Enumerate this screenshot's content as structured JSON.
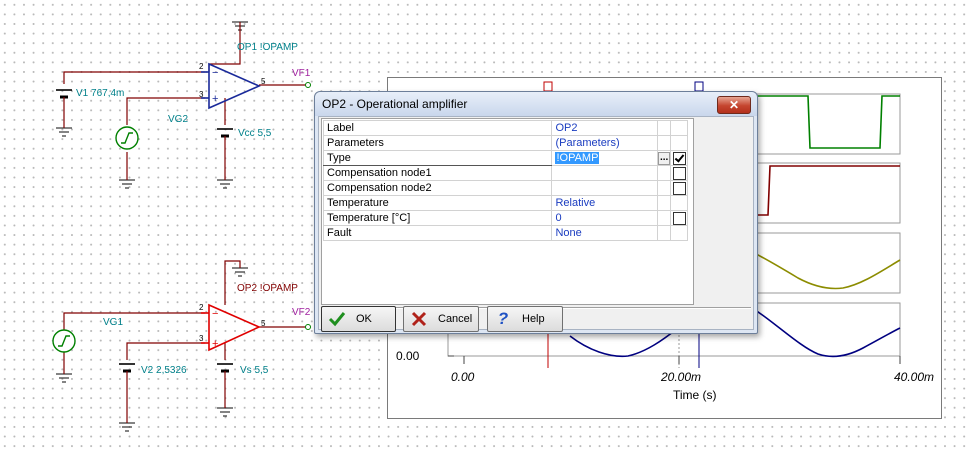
{
  "schematic": {
    "op1_label": "OP1 !OPAMP",
    "op2_label": "OP2 !OPAMP",
    "vf1": "VF1",
    "vf2": "VF2",
    "v1": "V1 767,4m",
    "vg2": "VG2",
    "vcc": "Vcc 5,5",
    "vg1": "VG1",
    "v2": "V2 2,5326",
    "vs": "Vs 5,5",
    "pin_2a": "2",
    "pin_3a": "3",
    "pin_5a": "5",
    "pin_2b": "2",
    "pin_3b": "3",
    "pin_5b": "5",
    "minus": "−",
    "plus": "+"
  },
  "graph": {
    "marker_a": "a",
    "marker_b": "b",
    "y_tick": "0.00",
    "x_ticks": [
      "0.00",
      "20.00m",
      "40.00m"
    ],
    "x_label": "Time (s)"
  },
  "dialog": {
    "title": "OP2 - Operational amplifier",
    "close": "✕",
    "rows": [
      {
        "name": "Label",
        "value": "OP2"
      },
      {
        "name": "Parameters",
        "value": "(Parameters)"
      },
      {
        "name": "Type",
        "value": "!OPAMP"
      },
      {
        "name": "Compensation node1",
        "value": ""
      },
      {
        "name": "Compensation node2",
        "value": ""
      },
      {
        "name": "Temperature",
        "value": "Relative"
      },
      {
        "name": "Temperature [°C]",
        "value": "0"
      },
      {
        "name": "Fault",
        "value": "None"
      }
    ],
    "ellipsis": "...",
    "ok_label": "OK",
    "cancel_label": "Cancel",
    "help_label": "Help"
  },
  "colors": {
    "op1": "#1a2a9a",
    "op2": "#e00000",
    "wire": "#800000",
    "green_trace": "#008000",
    "red_trace": "#800000",
    "olive_trace": "#8c8c00",
    "navy_trace": "#000080"
  }
}
